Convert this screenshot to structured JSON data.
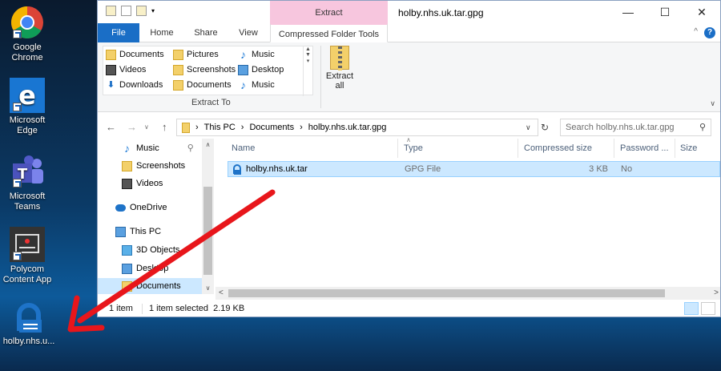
{
  "desktop": {
    "icons": [
      {
        "label_line1": "Google",
        "label_line2": "Chrome"
      },
      {
        "label_line1": "Microsoft",
        "label_line2": "Edge"
      },
      {
        "label_line1": "Microsoft",
        "label_line2": "Teams"
      },
      {
        "label_line1": "Polycom",
        "label_line2": "Content App"
      },
      {
        "label_line1": "holby.nhs.u...",
        "label_line2": ""
      }
    ]
  },
  "window": {
    "title": "holby.nhs.uk.tar.gpg",
    "context_group": "Extract",
    "controls": {
      "minimize": "—",
      "maximize": "☐",
      "close": "✕"
    }
  },
  "tabs": [
    "File",
    "Home",
    "Share",
    "View",
    "Compressed Folder Tools"
  ],
  "ribbon": {
    "extract_to_items": [
      "Documents",
      "Pictures",
      "Music",
      "Videos",
      "Screenshots",
      "Desktop",
      "Downloads",
      "Documents",
      "Music"
    ],
    "group_label": "Extract To",
    "extract_all_line1": "Extract",
    "extract_all_line2": "all"
  },
  "address": {
    "breadcrumb": [
      "This PC",
      "Documents",
      "holby.nhs.uk.tar.gpg"
    ],
    "search_placeholder": "Search holby.nhs.uk.tar.gpg"
  },
  "nav_pane": [
    "Music",
    "Screenshots",
    "Videos",
    "OneDrive",
    "This PC",
    "3D Objects",
    "Desktop",
    "Documents"
  ],
  "columns": [
    "Name",
    "Type",
    "Compressed size",
    "Password ...",
    "Size"
  ],
  "files": [
    {
      "name": "holby.nhs.uk.tar",
      "type": "GPG File",
      "compressed_size": "3 KB",
      "password": "No",
      "size": ""
    }
  ],
  "status": {
    "count": "1 item",
    "selected": "1 item selected  2.19 KB"
  },
  "colors": {
    "file_tab": "#1a6ec6",
    "context_header": "#f7c6de",
    "selection": "#cce8ff",
    "annotation_arrow": "#e8161b"
  }
}
